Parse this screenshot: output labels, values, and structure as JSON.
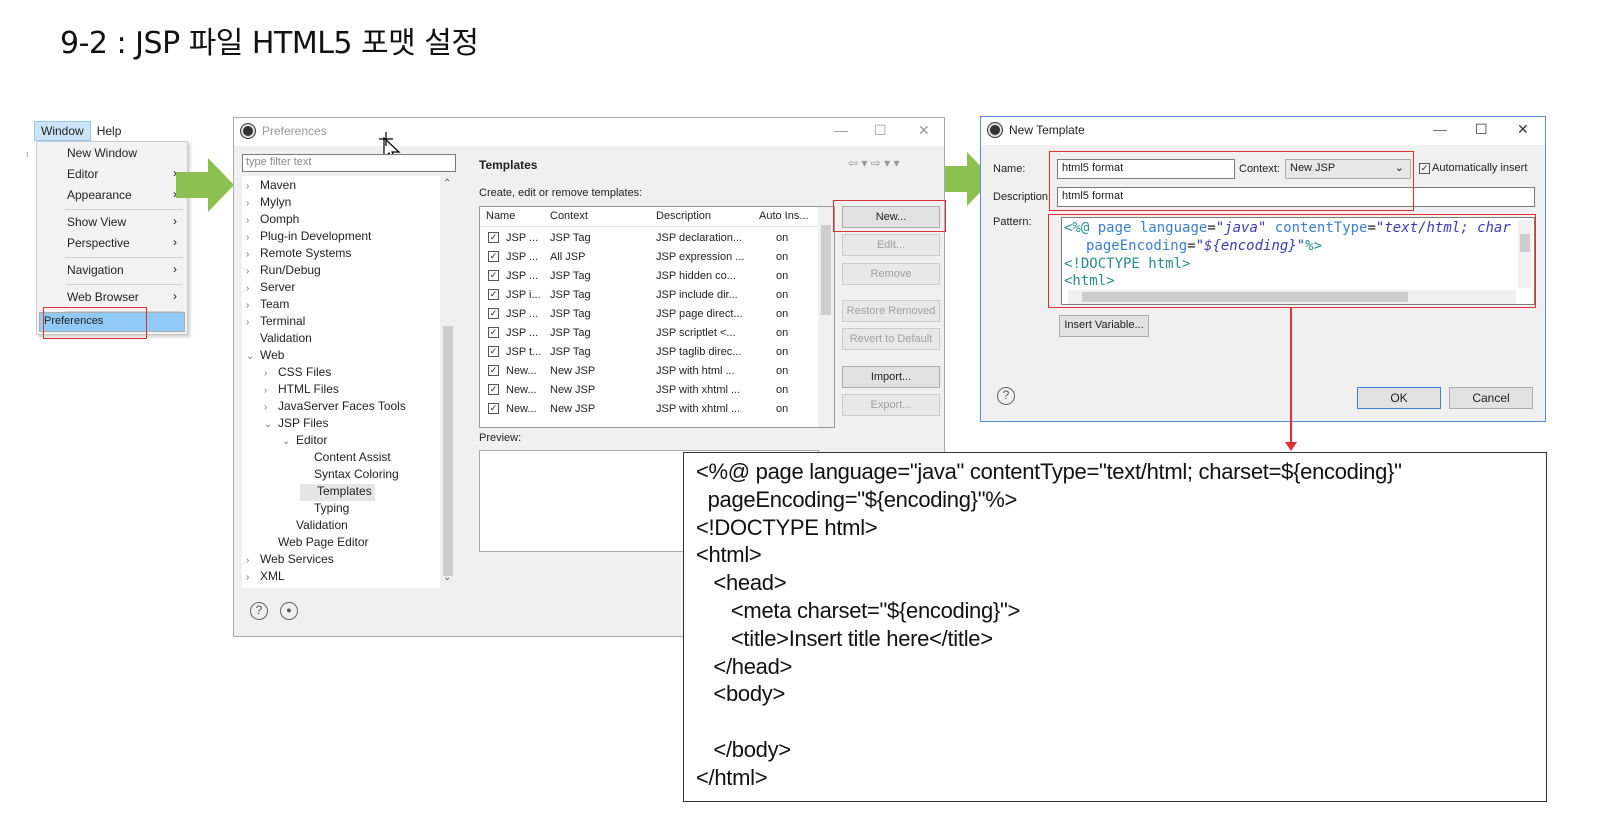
{
  "slide": {
    "title": "9-2 : JSP 파일 HTML5 포맷 설정"
  },
  "menubar": {
    "items": [
      "Window",
      "Help"
    ]
  },
  "window_menu": {
    "items": [
      "New Window",
      "Editor",
      "Appearance",
      "Show View",
      "Perspective",
      "Navigation",
      "Web Browser",
      "Preferences"
    ],
    "submenu_arrow": "›"
  },
  "preferences": {
    "title": "Preferences",
    "filter_placeholder": "type filter text",
    "tree": [
      {
        "label": "Maven",
        "twisty": "›"
      },
      {
        "label": "Mylyn",
        "twisty": "›"
      },
      {
        "label": "Oomph",
        "twisty": "›"
      },
      {
        "label": "Plug-in Development",
        "twisty": "›"
      },
      {
        "label": "Remote Systems",
        "twisty": "›"
      },
      {
        "label": "Run/Debug",
        "twisty": "›"
      },
      {
        "label": "Server",
        "twisty": "›"
      },
      {
        "label": "Team",
        "twisty": "›"
      },
      {
        "label": "Terminal",
        "twisty": "›"
      },
      {
        "label": "Validation",
        "twisty": ""
      },
      {
        "label": "Web",
        "twisty": "⌄"
      },
      {
        "label": "CSS Files",
        "twisty": "›"
      },
      {
        "label": "HTML Files",
        "twisty": "›"
      },
      {
        "label": "JavaServer Faces Tools",
        "twisty": "›"
      },
      {
        "label": "JSP Files",
        "twisty": "⌄"
      },
      {
        "label": "Editor",
        "twisty": "⌄"
      },
      {
        "label": "Content Assist",
        "twisty": ""
      },
      {
        "label": "Syntax Coloring",
        "twisty": ""
      },
      {
        "label": "Templates",
        "twisty": ""
      },
      {
        "label": "Typing",
        "twisty": ""
      },
      {
        "label": "Validation",
        "twisty": ""
      },
      {
        "label": "Web Page Editor",
        "twisty": ""
      },
      {
        "label": "Web Services",
        "twisty": "›"
      },
      {
        "label": "XML",
        "twisty": "›"
      }
    ],
    "panel_title": "Templates",
    "panel_desc": "Create, edit or remove templates:",
    "columns": [
      "Name",
      "Context",
      "Description",
      "Auto Ins..."
    ],
    "rows": [
      {
        "name": "JSP ...",
        "context": "JSP Tag",
        "description": "JSP declaration...",
        "auto": "on"
      },
      {
        "name": "JSP ...",
        "context": "All JSP",
        "description": "JSP expression ...",
        "auto": "on"
      },
      {
        "name": "JSP ...",
        "context": "JSP Tag",
        "description": "JSP hidden co...",
        "auto": "on"
      },
      {
        "name": "JSP i...",
        "context": "JSP Tag",
        "description": "JSP include dir...",
        "auto": "on"
      },
      {
        "name": "JSP ...",
        "context": "JSP Tag",
        "description": "JSP page direct...",
        "auto": "on"
      },
      {
        "name": "JSP ...",
        "context": "JSP Tag",
        "description": "JSP scriptlet <...",
        "auto": "on"
      },
      {
        "name": "JSP t...",
        "context": "JSP Tag",
        "description": "JSP taglib direc...",
        "auto": "on"
      },
      {
        "name": "New...",
        "context": "New JSP",
        "description": "JSP with html ...",
        "auto": "on"
      },
      {
        "name": "New...",
        "context": "New JSP",
        "description": "JSP with xhtml ...",
        "auto": "on"
      },
      {
        "name": "New...",
        "context": "New JSP",
        "description": "JSP with xhtml ...",
        "auto": "on"
      }
    ],
    "checkmark": "✓",
    "buttons": [
      "New...",
      "Edit...",
      "Remove",
      "Restore Removed",
      "Revert to Default",
      "Import...",
      "Export..."
    ],
    "preview_label": "Preview:"
  },
  "new_template": {
    "title": "New Template",
    "name_label": "Name:",
    "name_value": "html5 format",
    "context_label": "Context:",
    "context_value": "New JSP",
    "auto_insert_label": "Automatically insert",
    "description_label": "Description:",
    "description_value": "html5 format",
    "pattern_label": "Pattern:",
    "insert_variable": "Insert Variable...",
    "ok": "OK",
    "cancel": "Cancel"
  },
  "code_lines": [
    "<%@ page language=\"java\" contentType=\"text/html; charset=${encoding}\"",
    "  pageEncoding=\"${encoding}\"%>",
    "<!DOCTYPE html>",
    "<html>",
    "   <head>",
    "      <meta charset=\"${encoding}\">",
    "      <title>Insert title here</title>",
    "   </head>",
    "   <body>",
    "",
    "   </body>",
    "</html>"
  ],
  "colors": {
    "highlight_red": "#e03030",
    "arrow_green": "#8cc152",
    "selection_blue": "#91c9f7"
  }
}
